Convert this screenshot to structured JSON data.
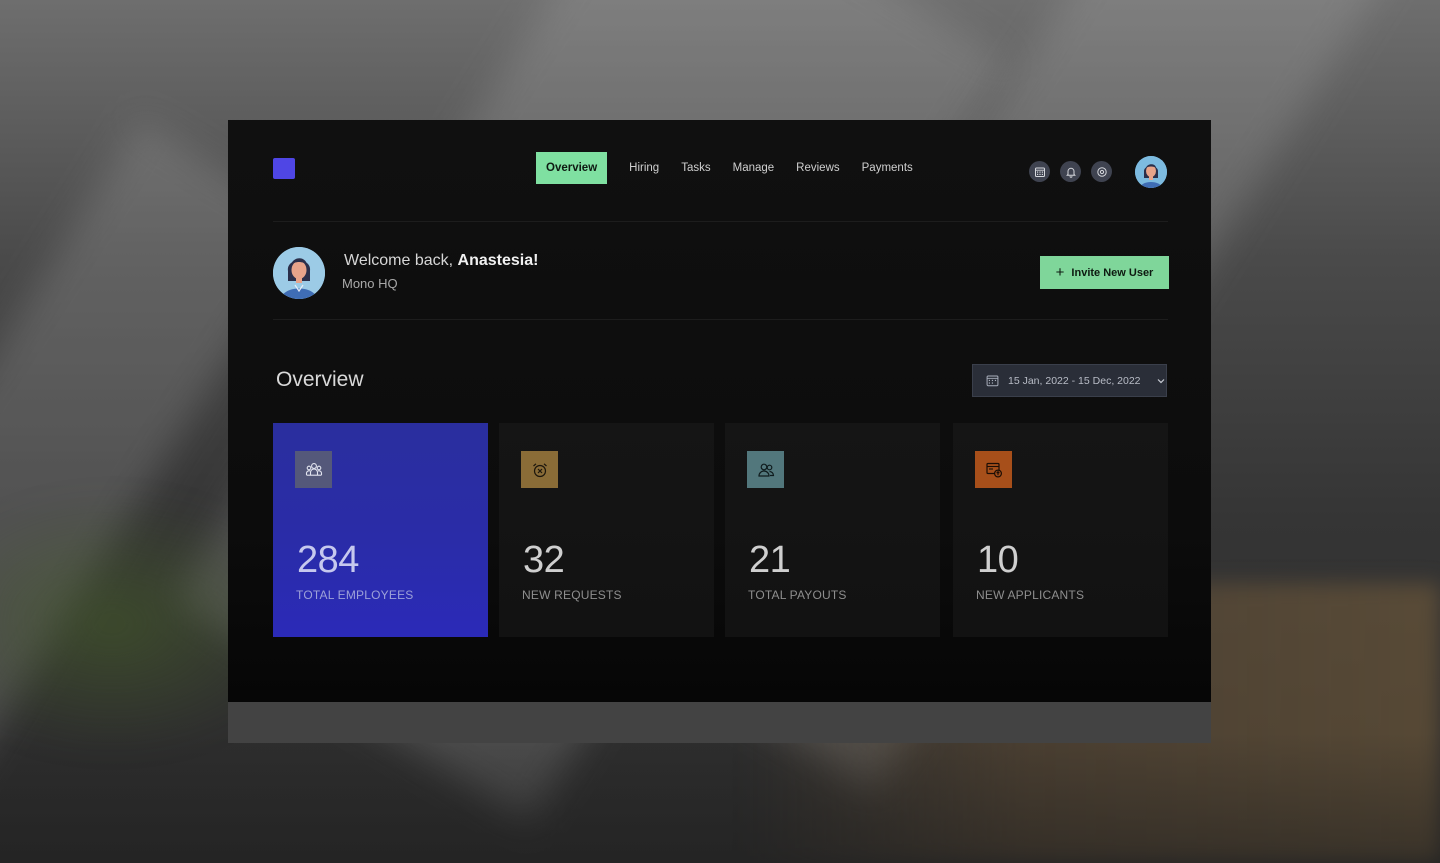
{
  "nav": {
    "items": [
      {
        "label": "Overview",
        "active": true
      },
      {
        "label": "Hiring",
        "active": false
      },
      {
        "label": "Tasks",
        "active": false
      },
      {
        "label": "Manage",
        "active": false
      },
      {
        "label": "Reviews",
        "active": false
      },
      {
        "label": "Payments",
        "active": false
      }
    ],
    "icons": [
      "calendar-icon",
      "bell-icon",
      "settings-icon"
    ]
  },
  "welcome": {
    "greeting": "Welcome back,",
    "name": "Anastesia!",
    "org": "Mono HQ"
  },
  "actions": {
    "invite_label": "Invite New User"
  },
  "overview": {
    "title": "Overview",
    "date_range": "15 Jan, 2022 - 15 Dec, 2022"
  },
  "stats": [
    {
      "value": "284",
      "label": "TOTAL EMPLOYEES",
      "icon": "users-group-icon",
      "icon_bg": "#54587a"
    },
    {
      "value": "32",
      "label": "NEW REQUESTS",
      "icon": "alarm-icon",
      "icon_bg": "#8a6c37"
    },
    {
      "value": "21",
      "label": "TOTAL PAYOUTS",
      "icon": "users-icon",
      "icon_bg": "#52777c"
    },
    {
      "value": "10",
      "label": "NEW APPLICANTS",
      "icon": "document-upload-icon",
      "icon_bg": "#a74f1a"
    }
  ],
  "colors": {
    "accent": "#7fd69a",
    "logo": "#4f46e5",
    "primary_card": "#2a2ca8",
    "app_bg": "#101010"
  }
}
